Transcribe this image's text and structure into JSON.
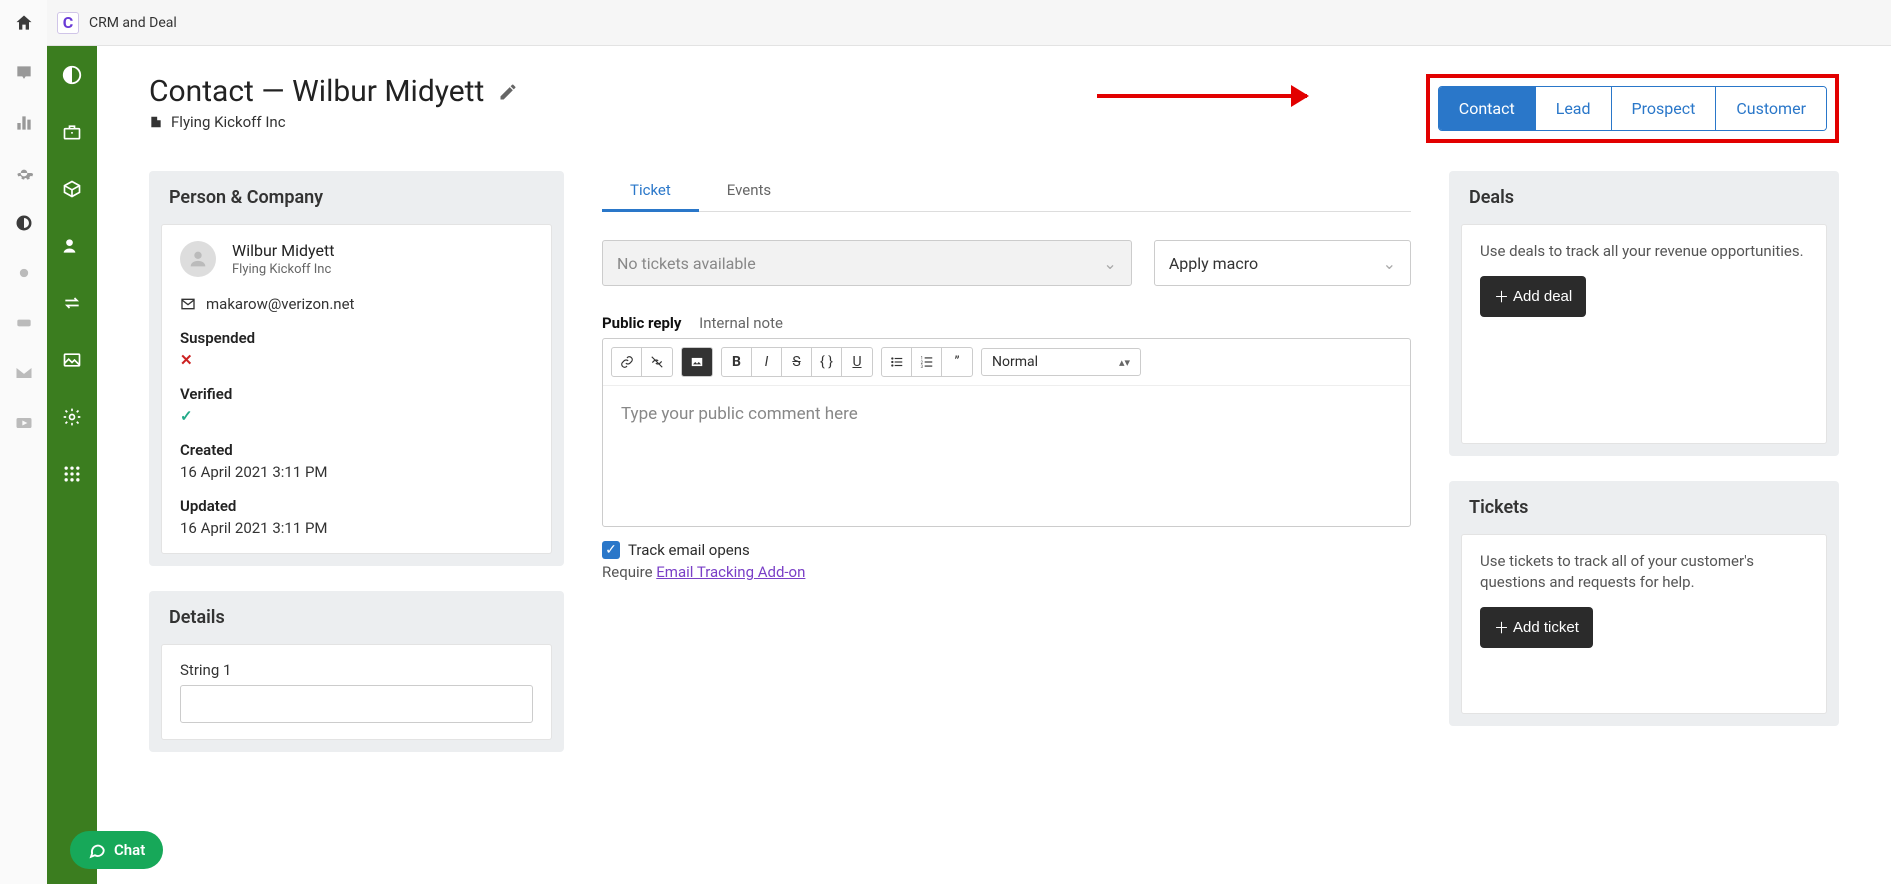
{
  "topbar": {
    "brand_letter": "C",
    "title": "CRM and Deal"
  },
  "header": {
    "title": "Contact — Wilbur Midyett",
    "company": "Flying Kickoff Inc"
  },
  "stages": [
    "Contact",
    "Lead",
    "Prospect",
    "Customer"
  ],
  "person_panel": {
    "title": "Person & Company",
    "name": "Wilbur Midyett",
    "company": "Flying Kickoff Inc",
    "email": "makarow@verizon.net",
    "suspended_label": "Suspended",
    "suspended_mark": "✕",
    "verified_label": "Verified",
    "verified_mark": "✓",
    "created_label": "Created",
    "created_val": "16 April 2021 3:11 PM",
    "updated_label": "Updated",
    "updated_val": "16 April 2021 3:11 PM"
  },
  "details_panel": {
    "title": "Details",
    "string1_label": "String 1"
  },
  "center": {
    "tab_ticket": "Ticket",
    "tab_events": "Events",
    "no_tickets": "No tickets available",
    "apply_macro": "Apply macro",
    "public_reply": "Public reply",
    "internal_note": "Internal note",
    "format_normal": "Normal",
    "editor_placeholder": "Type your public comment here",
    "track_label": "Track email opens",
    "require_prefix": "Require ",
    "require_link": "Email Tracking Add-on"
  },
  "deals_panel": {
    "title": "Deals",
    "text": "Use deals to track all your revenue opportunities.",
    "button": "Add deal"
  },
  "tickets_panel": {
    "title": "Tickets",
    "text": "Use tickets to track all of your customer's questions and requests for help.",
    "button": "Add ticket"
  },
  "chat": {
    "label": "Chat"
  }
}
